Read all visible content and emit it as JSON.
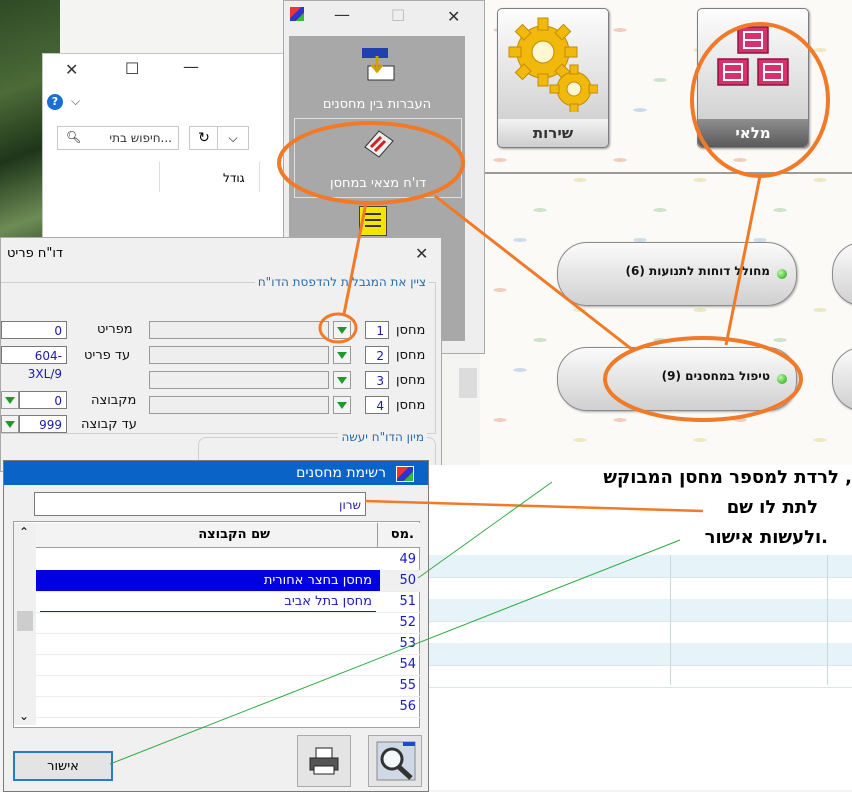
{
  "explorer": {
    "search_placeholder": "חיפוש בתי...",
    "column_size": "גודל"
  },
  "launcher": {
    "items": [
      {
        "label": "העברות בין מחסנים",
        "icon": "transfer-icon"
      },
      {
        "label": "דו'ח מצאי במחסן",
        "icon": "inventory-report-icon"
      }
    ]
  },
  "tiles": [
    {
      "label": "שירות",
      "icon": "gears-icon"
    },
    {
      "label": "מלאי",
      "icon": "warehouse-boxes-icon"
    }
  ],
  "menu": {
    "reports_generator": "(6) מחולל דוחות לתנועות",
    "warehouse_handling": "(9) טיפול במחסנים"
  },
  "report": {
    "title": "דו\"ח פריט",
    "group_label": "ציין את המגבלות להדפסת הדו\"ח",
    "from_item_label": "מפריט",
    "from_item_value": "0",
    "to_item_label": "עד פריט",
    "to_item_value": "604-3XL/9",
    "from_group_label": "מקבוצה",
    "from_group_value": "0",
    "to_group_label": "עד קבוצה",
    "to_group_value": "999",
    "warehouse_label": "מחסן",
    "warehouses": [
      "1",
      "2",
      "3",
      "4"
    ],
    "sort_label": "מיון הדו\"ח יעשה"
  },
  "warehouse_list": {
    "title": "רשימת מחסנים",
    "search_value": "שרון",
    "col_number": "מס.",
    "col_name": "שם הקבוצה",
    "rows": [
      {
        "num": "49",
        "name": ""
      },
      {
        "num": "50",
        "name": "מחסן בחצר אחורית",
        "selected": true
      },
      {
        "num": "51",
        "name": "מחסן בתל אביב"
      },
      {
        "num": "52",
        "name": ""
      },
      {
        "num": "53",
        "name": ""
      },
      {
        "num": "54",
        "name": ""
      },
      {
        "num": "55",
        "name": ""
      },
      {
        "num": "56",
        "name": ""
      }
    ],
    "ok_label": "אישור"
  },
  "annotation": {
    "line1": "לרדת למספר מחסן המבוקש ,",
    "line2": "לתת לו שם",
    "line3": "ולעשות אישור."
  },
  "colors": {
    "annotation_orange": "#f07a28",
    "selection_blue": "#0000e0",
    "dialog_title_blue": "#0a64c8",
    "pink_tile": "#d6336c"
  }
}
